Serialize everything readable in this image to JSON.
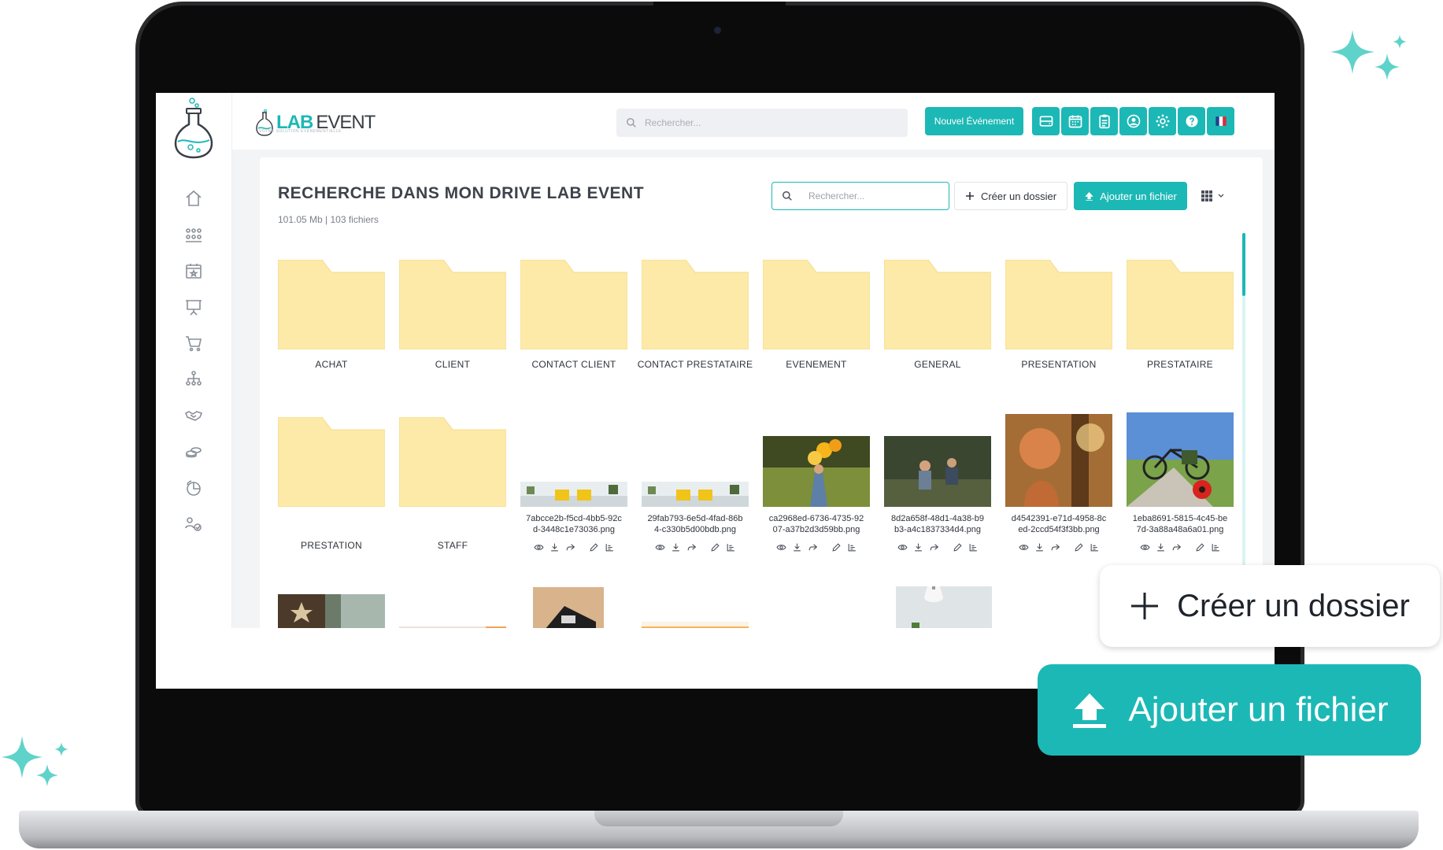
{
  "app": {
    "brand_lab": "LAB",
    "brand_event": "EVENT",
    "brand_tagline": "VOTRE SOLUTION ÉVÉNEMENTIELLE"
  },
  "topbar": {
    "search_placeholder": "Rechercher...",
    "new_event_label": "Nouvel Événement",
    "icons": [
      "dashboard-icon",
      "calendar-icon",
      "clipboard-icon",
      "user-icon",
      "gear-icon",
      "help-icon",
      "flag-fr-icon"
    ]
  },
  "sidebar": {
    "items": [
      "home-icon",
      "team-icon",
      "event-calendar-icon",
      "presentation-icon",
      "cart-icon",
      "hierarchy-icon",
      "handshake-icon",
      "coins-icon",
      "chart-icon",
      "settings-users-icon"
    ]
  },
  "drive": {
    "title": "RECHERCHE DANS MON DRIVE LAB EVENT",
    "subtitle": "101.05 Mb | 103 fichiers",
    "search_placeholder": "Rechercher...",
    "create_folder_label": "Créer un dossier",
    "upload_label": "Ajouter un fichier",
    "folders": [
      "ACHAT",
      "CLIENT",
      "CONTACT CLIENT",
      "CONTACT PRESTATAIRE",
      "EVENEMENT",
      "GENERAL",
      "PRESENTATION",
      "PRESTATAIRE",
      "PRESTATION",
      "STAFF"
    ],
    "files": [
      {
        "line1": "7abcce2b-f5cd-4bb5-92c",
        "line2": "d-3448c1e73036.png"
      },
      {
        "line1": "29fab793-6e5d-4fad-86b",
        "line2": "4-c330b5d00bdb.png"
      },
      {
        "line1": "ca2968ed-6736-4735-92",
        "line2": "07-a37b2d3d59bb.png"
      },
      {
        "line1": "8d2a658f-48d1-4a38-b9",
        "line2": "b3-a4c1837334d4.png"
      },
      {
        "line1": "d4542391-e71d-4958-8c",
        "line2": "ed-2ccd54f3f3bb.png"
      },
      {
        "line1": "1eba8691-5815-4c45-be",
        "line2": "7d-3a88a48a6a01.png"
      }
    ]
  },
  "callouts": {
    "create_folder_label": "Créer un dossier",
    "upload_label": "Ajouter un fichier"
  },
  "colors": {
    "accent": "#1cb8b5",
    "folder": "#fdeaa8",
    "sparkle": "#5fd3c9"
  }
}
